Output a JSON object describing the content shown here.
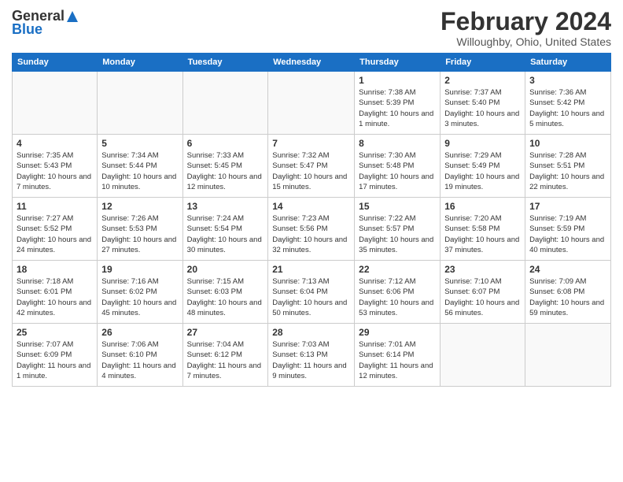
{
  "header": {
    "logo_general": "General",
    "logo_blue": "Blue",
    "main_title": "February 2024",
    "subtitle": "Willoughby, Ohio, United States"
  },
  "calendar": {
    "days_of_week": [
      "Sunday",
      "Monday",
      "Tuesday",
      "Wednesday",
      "Thursday",
      "Friday",
      "Saturday"
    ],
    "weeks": [
      [
        {
          "day": "",
          "info": ""
        },
        {
          "day": "",
          "info": ""
        },
        {
          "day": "",
          "info": ""
        },
        {
          "day": "",
          "info": ""
        },
        {
          "day": "1",
          "info": "Sunrise: 7:38 AM\nSunset: 5:39 PM\nDaylight: 10 hours and 1 minute."
        },
        {
          "day": "2",
          "info": "Sunrise: 7:37 AM\nSunset: 5:40 PM\nDaylight: 10 hours and 3 minutes."
        },
        {
          "day": "3",
          "info": "Sunrise: 7:36 AM\nSunset: 5:42 PM\nDaylight: 10 hours and 5 minutes."
        }
      ],
      [
        {
          "day": "4",
          "info": "Sunrise: 7:35 AM\nSunset: 5:43 PM\nDaylight: 10 hours and 7 minutes."
        },
        {
          "day": "5",
          "info": "Sunrise: 7:34 AM\nSunset: 5:44 PM\nDaylight: 10 hours and 10 minutes."
        },
        {
          "day": "6",
          "info": "Sunrise: 7:33 AM\nSunset: 5:45 PM\nDaylight: 10 hours and 12 minutes."
        },
        {
          "day": "7",
          "info": "Sunrise: 7:32 AM\nSunset: 5:47 PM\nDaylight: 10 hours and 15 minutes."
        },
        {
          "day": "8",
          "info": "Sunrise: 7:30 AM\nSunset: 5:48 PM\nDaylight: 10 hours and 17 minutes."
        },
        {
          "day": "9",
          "info": "Sunrise: 7:29 AM\nSunset: 5:49 PM\nDaylight: 10 hours and 19 minutes."
        },
        {
          "day": "10",
          "info": "Sunrise: 7:28 AM\nSunset: 5:51 PM\nDaylight: 10 hours and 22 minutes."
        }
      ],
      [
        {
          "day": "11",
          "info": "Sunrise: 7:27 AM\nSunset: 5:52 PM\nDaylight: 10 hours and 24 minutes."
        },
        {
          "day": "12",
          "info": "Sunrise: 7:26 AM\nSunset: 5:53 PM\nDaylight: 10 hours and 27 minutes."
        },
        {
          "day": "13",
          "info": "Sunrise: 7:24 AM\nSunset: 5:54 PM\nDaylight: 10 hours and 30 minutes."
        },
        {
          "day": "14",
          "info": "Sunrise: 7:23 AM\nSunset: 5:56 PM\nDaylight: 10 hours and 32 minutes."
        },
        {
          "day": "15",
          "info": "Sunrise: 7:22 AM\nSunset: 5:57 PM\nDaylight: 10 hours and 35 minutes."
        },
        {
          "day": "16",
          "info": "Sunrise: 7:20 AM\nSunset: 5:58 PM\nDaylight: 10 hours and 37 minutes."
        },
        {
          "day": "17",
          "info": "Sunrise: 7:19 AM\nSunset: 5:59 PM\nDaylight: 10 hours and 40 minutes."
        }
      ],
      [
        {
          "day": "18",
          "info": "Sunrise: 7:18 AM\nSunset: 6:01 PM\nDaylight: 10 hours and 42 minutes."
        },
        {
          "day": "19",
          "info": "Sunrise: 7:16 AM\nSunset: 6:02 PM\nDaylight: 10 hours and 45 minutes."
        },
        {
          "day": "20",
          "info": "Sunrise: 7:15 AM\nSunset: 6:03 PM\nDaylight: 10 hours and 48 minutes."
        },
        {
          "day": "21",
          "info": "Sunrise: 7:13 AM\nSunset: 6:04 PM\nDaylight: 10 hours and 50 minutes."
        },
        {
          "day": "22",
          "info": "Sunrise: 7:12 AM\nSunset: 6:06 PM\nDaylight: 10 hours and 53 minutes."
        },
        {
          "day": "23",
          "info": "Sunrise: 7:10 AM\nSunset: 6:07 PM\nDaylight: 10 hours and 56 minutes."
        },
        {
          "day": "24",
          "info": "Sunrise: 7:09 AM\nSunset: 6:08 PM\nDaylight: 10 hours and 59 minutes."
        }
      ],
      [
        {
          "day": "25",
          "info": "Sunrise: 7:07 AM\nSunset: 6:09 PM\nDaylight: 11 hours and 1 minute."
        },
        {
          "day": "26",
          "info": "Sunrise: 7:06 AM\nSunset: 6:10 PM\nDaylight: 11 hours and 4 minutes."
        },
        {
          "day": "27",
          "info": "Sunrise: 7:04 AM\nSunset: 6:12 PM\nDaylight: 11 hours and 7 minutes."
        },
        {
          "day": "28",
          "info": "Sunrise: 7:03 AM\nSunset: 6:13 PM\nDaylight: 11 hours and 9 minutes."
        },
        {
          "day": "29",
          "info": "Sunrise: 7:01 AM\nSunset: 6:14 PM\nDaylight: 11 hours and 12 minutes."
        },
        {
          "day": "",
          "info": ""
        },
        {
          "day": "",
          "info": ""
        }
      ]
    ]
  }
}
